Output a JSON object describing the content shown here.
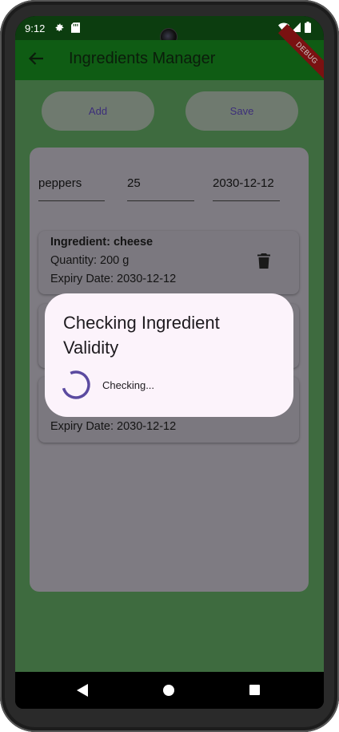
{
  "status_bar": {
    "time": "9:12",
    "icons": [
      "gear-icon",
      "sd-card-icon",
      "wifi-icon",
      "signal-icon",
      "battery-icon"
    ]
  },
  "app_bar": {
    "title": "Ingredients Manager",
    "back_icon": "back-arrow-icon",
    "debug_banner": "DEBUG",
    "color": "#0f5c14"
  },
  "actions": {
    "add_label": "Add",
    "save_label": "Save"
  },
  "form": {
    "name_value": "peppers",
    "quantity_value": "25",
    "expiry_value": "2030-12-12"
  },
  "ingredients": [
    {
      "title": "Ingredient: cheese",
      "quantity": "Quantity: 200 g",
      "expiry": "Expiry Date: 2030-12-12"
    },
    {
      "title": "",
      "quantity": "",
      "expiry": ""
    },
    {
      "title": "",
      "quantity": "",
      "expiry": "Expiry Date: 2030-12-12"
    }
  ],
  "dialog": {
    "title": "Checking Ingredient Validity",
    "status": "Checking...",
    "accent": "#5b4aa0"
  },
  "nav_bar": {
    "icons": [
      "nav-back-icon",
      "nav-home-icon",
      "nav-recents-icon"
    ]
  }
}
